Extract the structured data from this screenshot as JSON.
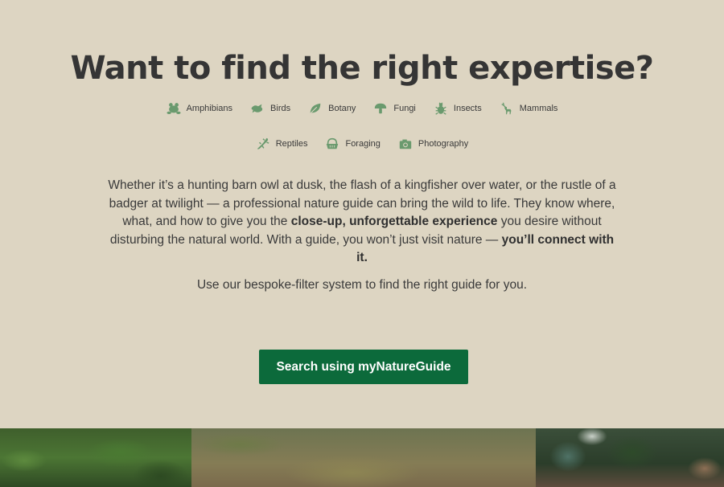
{
  "hero": {
    "title": "Want to find the right expertise?",
    "categories_row1": [
      {
        "label": "Amphibians",
        "icon": "frog-icon"
      },
      {
        "label": "Birds",
        "icon": "bird-icon"
      },
      {
        "label": "Botany",
        "icon": "leaf-icon"
      },
      {
        "label": "Fungi",
        "icon": "mushroom-icon"
      },
      {
        "label": "Insects",
        "icon": "bug-icon"
      },
      {
        "label": "Mammals",
        "icon": "deer-icon"
      }
    ],
    "categories_row2": [
      {
        "label": "Reptiles",
        "icon": "lizard-icon"
      },
      {
        "label": "Foraging",
        "icon": "basket-icon"
      },
      {
        "label": "Photography",
        "icon": "camera-icon"
      }
    ],
    "body": {
      "part1": "Whether it’s a hunting barn owl at dusk, the flash of a kingfisher over water, or the rustle of a badger at twilight — a professional nature guide can bring the wild to life. They know where, what, and how to give you the ",
      "bold1": "close-up, unforgettable experience",
      "part2": " you desire without disturbing the natural world. With a guide, you won’t just visit nature — ",
      "bold2": "you’ll connect with it."
    },
    "tagline": "Use our bespoke-filter system to find the right guide for you.",
    "cta_label": "Search using myNatureGuide"
  },
  "colors": {
    "background": "#ddd5c2",
    "icon_green": "#6a9a6e",
    "cta_green": "#0c6a3b",
    "text": "#333333"
  }
}
